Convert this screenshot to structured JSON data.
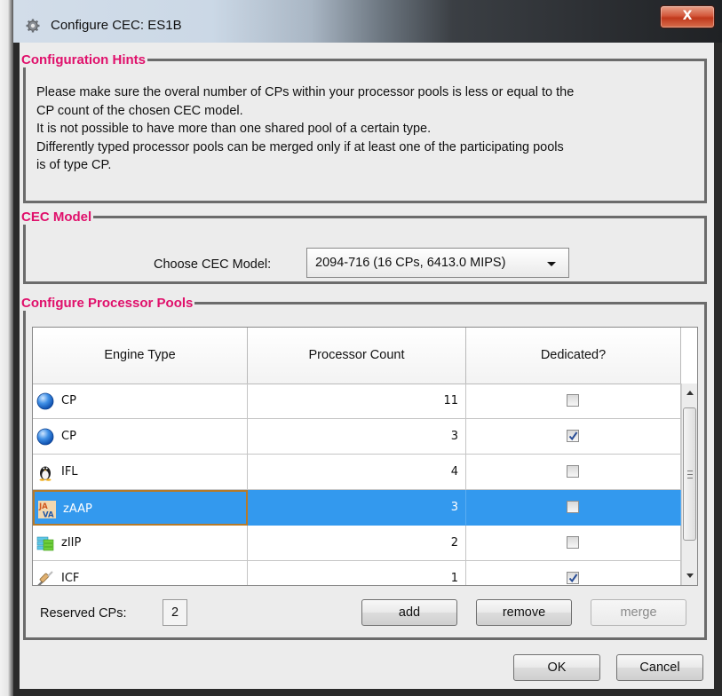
{
  "window": {
    "title": "Configure CEC: ES1B",
    "close_label": "X"
  },
  "hints": {
    "legend": "Configuration Hints",
    "lines": [
      "Please make sure the overal number of CPs within your processor pools is less or equal to the",
      "CP count of the chosen CEC model.",
      "It is not possible to have more than one shared pool of a certain type.",
      "Differently typed processor pools can be merged only if at least one of the participating pools",
      "is of type CP."
    ]
  },
  "model": {
    "legend": "CEC Model",
    "label": "Choose CEC Model:",
    "selected": "2094-716 (16 CPs, 6413.0 MIPS)"
  },
  "pools": {
    "legend": "Configure Processor Pools",
    "columns": [
      "Engine Type",
      "Processor Count",
      "Dedicated?"
    ],
    "rows": [
      {
        "engine": "CP",
        "icon": "globe-icon",
        "count": "11",
        "dedicated": false,
        "selected": false
      },
      {
        "engine": "CP",
        "icon": "globe-icon",
        "count": "3",
        "dedicated": true,
        "selected": false
      },
      {
        "engine": "IFL",
        "icon": "linux-penguin-icon",
        "count": "4",
        "dedicated": false,
        "selected": false
      },
      {
        "engine": "zAAP",
        "icon": "java-icon",
        "count": "3",
        "dedicated": false,
        "selected": true
      },
      {
        "engine": "zIIP",
        "icon": "database-icon",
        "count": "2",
        "dedicated": false,
        "selected": false
      },
      {
        "engine": "ICF",
        "icon": "cable-icon",
        "count": "1",
        "dedicated": true,
        "selected": false
      }
    ],
    "reserved_label": "Reserved CPs:",
    "reserved_value": "2",
    "add_label": "add",
    "remove_label": "remove",
    "merge_label": "merge"
  },
  "footer": {
    "ok_label": "OK",
    "cancel_label": "Cancel"
  },
  "colors": {
    "legend": "#e0106b",
    "selection": "#3399ee"
  }
}
